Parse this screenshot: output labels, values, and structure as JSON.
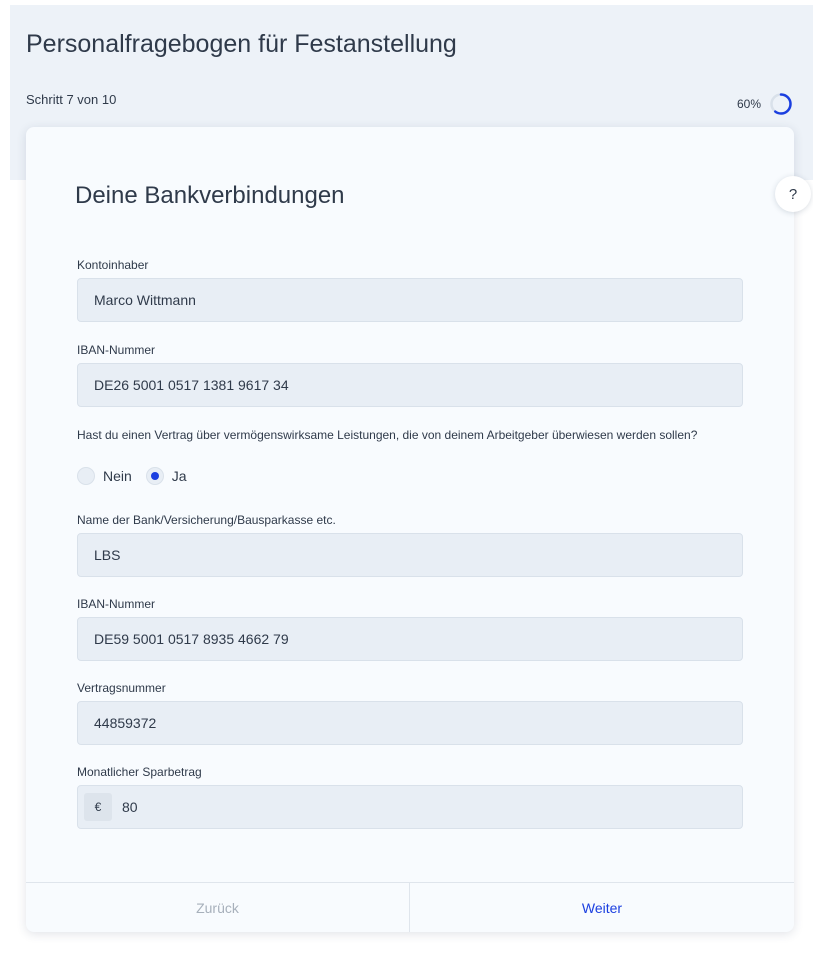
{
  "header": {
    "title": "Personalfragebogen für Festanstellung",
    "step_text": "Schritt 7 von 10",
    "progress_text": "60%",
    "progress_value": 0.6,
    "accent_color": "#1b3fe0"
  },
  "help": {
    "label": "?"
  },
  "section": {
    "title": "Deine Bankverbindungen"
  },
  "fields": {
    "account_holder": {
      "label": "Kontoinhaber",
      "value": "Marco Wittmann"
    },
    "iban_1": {
      "label": "IBAN-Nummer",
      "value": "DE26 5001 0517 1381 9617 34"
    },
    "question": {
      "label": "Hast du einen Vertrag über vermögenswirksame Leistungen, die von deinem Arbeitgeber überwiesen werden sollen?",
      "options": [
        {
          "label": "Nein",
          "selected": false
        },
        {
          "label": "Ja",
          "selected": true
        }
      ]
    },
    "bank_name": {
      "label": "Name der Bank/Versicherung/Bausparkasse etc.",
      "value": "LBS"
    },
    "iban_2": {
      "label": "IBAN-Nummer",
      "value": "DE59 5001 0517 8935 4662 79"
    },
    "contract_number": {
      "label": "Vertragsnummer",
      "value": "44859372"
    },
    "monthly_amount": {
      "label": "Monatlicher Sparbetrag",
      "currency": "€",
      "value": "80"
    }
  },
  "footer": {
    "back_label": "Zurück",
    "next_label": "Weiter"
  }
}
